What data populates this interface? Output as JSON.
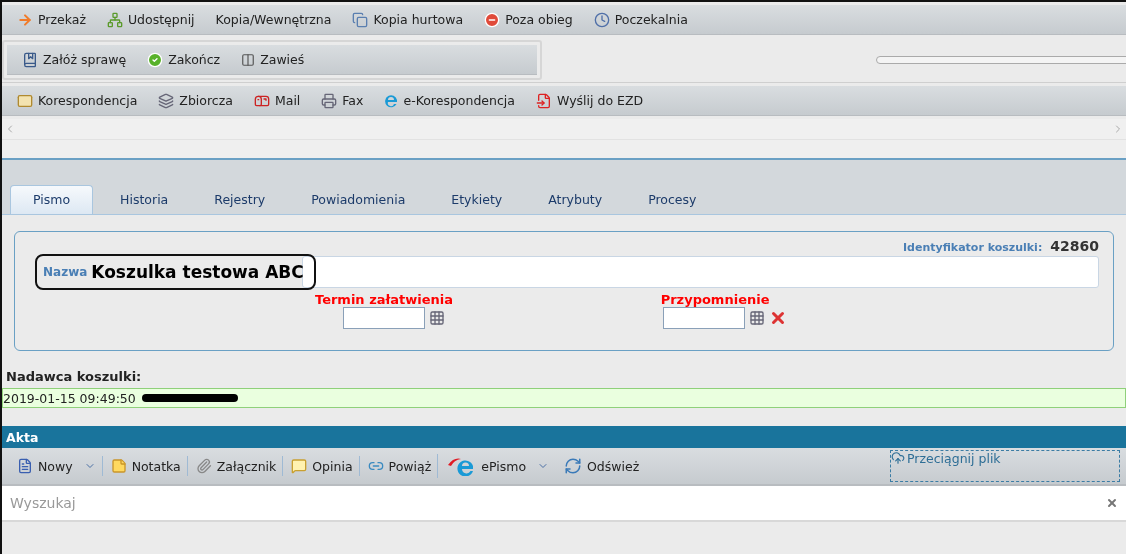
{
  "toolbar_1": [
    {
      "label": "Przekaż"
    },
    {
      "label": "Udostępnij"
    },
    {
      "label": "Kopia/Wewnętrzna"
    },
    {
      "label": "Kopia hurtowa"
    },
    {
      "label": "Poza obieg"
    },
    {
      "label": "Poczekalnia"
    }
  ],
  "toolbar_2": [
    {
      "label": "Załóż sprawę"
    },
    {
      "label": "Zakończ"
    },
    {
      "label": "Zawieś"
    }
  ],
  "toolbar_3": [
    {
      "label": "Korespondencja"
    },
    {
      "label": "Zbiorcza"
    },
    {
      "label": "Mail"
    },
    {
      "label": "Fax"
    },
    {
      "label": "e-Korespondencja"
    },
    {
      "label": "Wyślij do EZD"
    }
  ],
  "tabs": [
    {
      "label": "Pismo",
      "selected": true
    },
    {
      "label": "Historia",
      "selected": false
    },
    {
      "label": "Rejestry",
      "selected": false
    },
    {
      "label": "Powiadomienia",
      "selected": false
    },
    {
      "label": "Etykiety",
      "selected": false
    },
    {
      "label": "Atrybuty",
      "selected": false
    },
    {
      "label": "Procesy",
      "selected": false
    }
  ],
  "form": {
    "id_label": "Identyfikator koszulki:",
    "id_value": "42860",
    "name_label": "Nazwa",
    "name_value": "Koszulka testowa ABC",
    "due_label": "Termin załatwienia",
    "reminder_label": "Przypomnienie"
  },
  "sender": {
    "label": "Nadawca koszulki:",
    "timestamp": "2019-01-15 09:49:50"
  },
  "files": {
    "title": "Akta",
    "actions": [
      {
        "label": "Nowy",
        "dropdown": true,
        "divider_before": false
      },
      {
        "label": "Notatka",
        "dropdown": false,
        "divider_before": true
      },
      {
        "label": "Załącznik",
        "dropdown": false,
        "divider_before": true
      },
      {
        "label": "Opinia",
        "dropdown": false,
        "divider_before": true
      },
      {
        "label": "Powiąż",
        "dropdown": false,
        "divider_before": true
      },
      {
        "label": "ePismo",
        "dropdown": true,
        "divider_before": true
      },
      {
        "label": "Odśwież",
        "dropdown": false,
        "divider_before": false
      }
    ],
    "drop_zone": "Przeciągnij plik",
    "search": {
      "placeholder": "Wyszukaj"
    }
  }
}
